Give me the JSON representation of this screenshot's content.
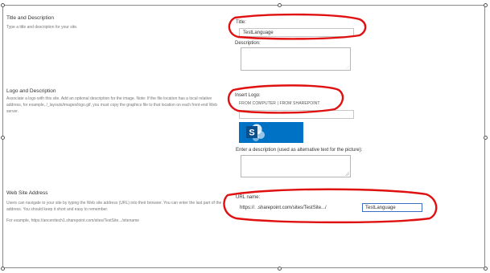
{
  "title_section": {
    "heading": "Title and Description",
    "description": "Type a title and description for your site.",
    "title_label": "Title:",
    "title_value": "TestLanguage",
    "description_label": "Description:"
  },
  "logo_section": {
    "heading": "Logo and Description",
    "description": "Associate a logo with this site. Add an optional description for the image. Note: If the file location has a local relative address, for example, /_layouts/images/logo.gif, you must copy the graphics file to that location on each front-end Web server.",
    "insert_logo_label": "Insert Logo:",
    "from_computer": "FROM COMPUTER",
    "separator": "|",
    "from_sharepoint": "FROM SHAREPOINT",
    "logo_icon": "sharepoint-logo",
    "alt_text_label": "Enter a description (used as alternative text for the picture):"
  },
  "web_address_section": {
    "heading": "Web Site Address",
    "description": "Users can navigate to your site by typing the Web site address (URL) into their browser. You can enter the last part of the address. You should keep it short and easy to remember.",
    "example": "For example, https://ancenttech1.sharepoint.com/sites/TestSite.../sitename",
    "url_label": "URL name:",
    "url_prefix": "https://.          .sharepoint.com/sites/TestSite.../",
    "url_value": "TestLanguage"
  },
  "colors": {
    "annotation": "#e01010",
    "sharepoint_blue": "#0072c6",
    "input_focus_border": "#3a6fc4"
  }
}
